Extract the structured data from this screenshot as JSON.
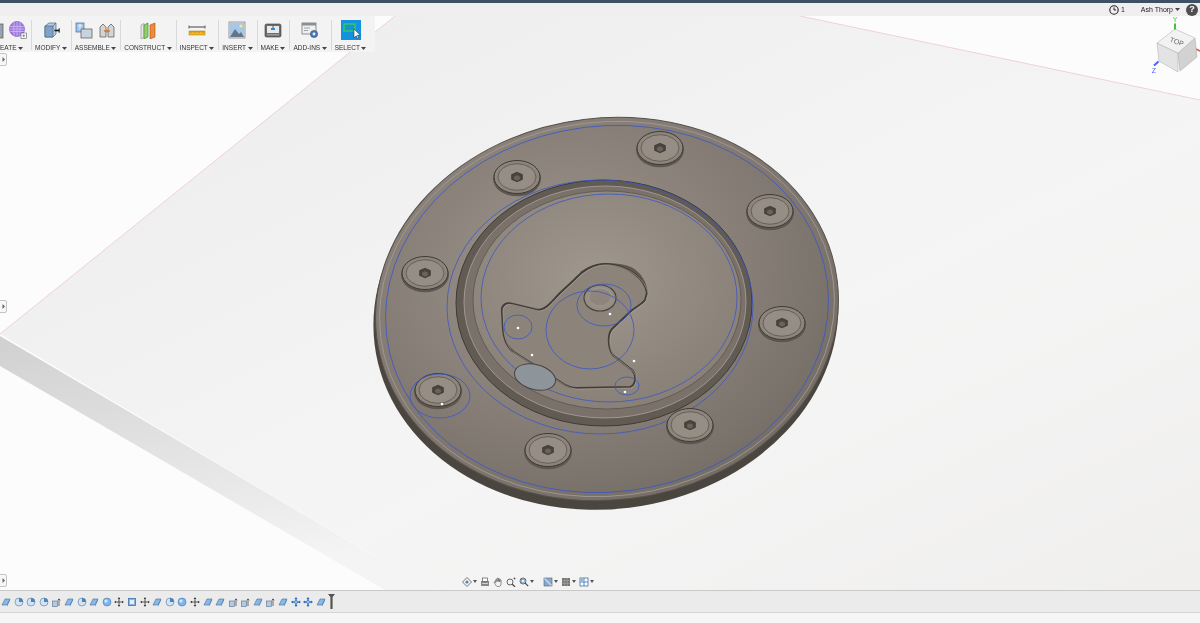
{
  "header": {
    "job_count": "1",
    "user": "Ash Thorp",
    "help": "?"
  },
  "toolbar": {
    "groups": [
      {
        "kind": "create",
        "label": "EATE",
        "selected": false
      },
      {
        "kind": "modify",
        "label": "MODIFY",
        "selected": false
      },
      {
        "kind": "assemble",
        "label": "ASSEMBLE",
        "selected": false
      },
      {
        "kind": "construct",
        "label": "CONSTRUCT",
        "selected": false
      },
      {
        "kind": "inspect",
        "label": "INSPECT",
        "selected": false
      },
      {
        "kind": "insert",
        "label": "INSERT",
        "selected": false
      },
      {
        "kind": "make",
        "label": "MAKE",
        "selected": false
      },
      {
        "kind": "addins",
        "label": "ADD-INS",
        "selected": false
      },
      {
        "kind": "select",
        "label": "SELECT",
        "selected": true
      }
    ]
  },
  "view_cube": {
    "face": "TOP",
    "axes": [
      {
        "label": "Y",
        "color": "#3cc83c"
      },
      {
        "label": "Z",
        "color": "#4a62ff"
      }
    ]
  },
  "navigation_bar": {
    "tools": [
      {
        "kind": "orbit",
        "dropdown": true
      },
      {
        "kind": "lookat",
        "dropdown": false
      },
      {
        "kind": "pan",
        "dropdown": false
      },
      {
        "kind": "zoom",
        "dropdown": false
      },
      {
        "kind": "fit",
        "dropdown": true
      },
      {
        "kind": "display",
        "dropdown": true
      },
      {
        "kind": "grid",
        "dropdown": true
      },
      {
        "kind": "viewports",
        "dropdown": true
      }
    ]
  },
  "timeline": {
    "features": [
      {
        "kind": "body"
      },
      {
        "kind": "fillet"
      },
      {
        "kind": "fillet"
      },
      {
        "kind": "fillet"
      },
      {
        "kind": "extrude"
      },
      {
        "kind": "body"
      },
      {
        "kind": "fillet"
      },
      {
        "kind": "body"
      },
      {
        "kind": "sphere"
      },
      {
        "kind": "move"
      },
      {
        "kind": "plane"
      },
      {
        "kind": "move"
      },
      {
        "kind": "body"
      },
      {
        "kind": "fillet"
      },
      {
        "kind": "sphere"
      },
      {
        "kind": "move"
      },
      {
        "kind": "body"
      },
      {
        "kind": "body"
      },
      {
        "kind": "extrude"
      },
      {
        "kind": "extrude"
      },
      {
        "kind": "body"
      },
      {
        "kind": "extrude"
      },
      {
        "kind": "body"
      },
      {
        "kind": "joint"
      },
      {
        "kind": "joint"
      },
      {
        "kind": "body"
      }
    ]
  }
}
